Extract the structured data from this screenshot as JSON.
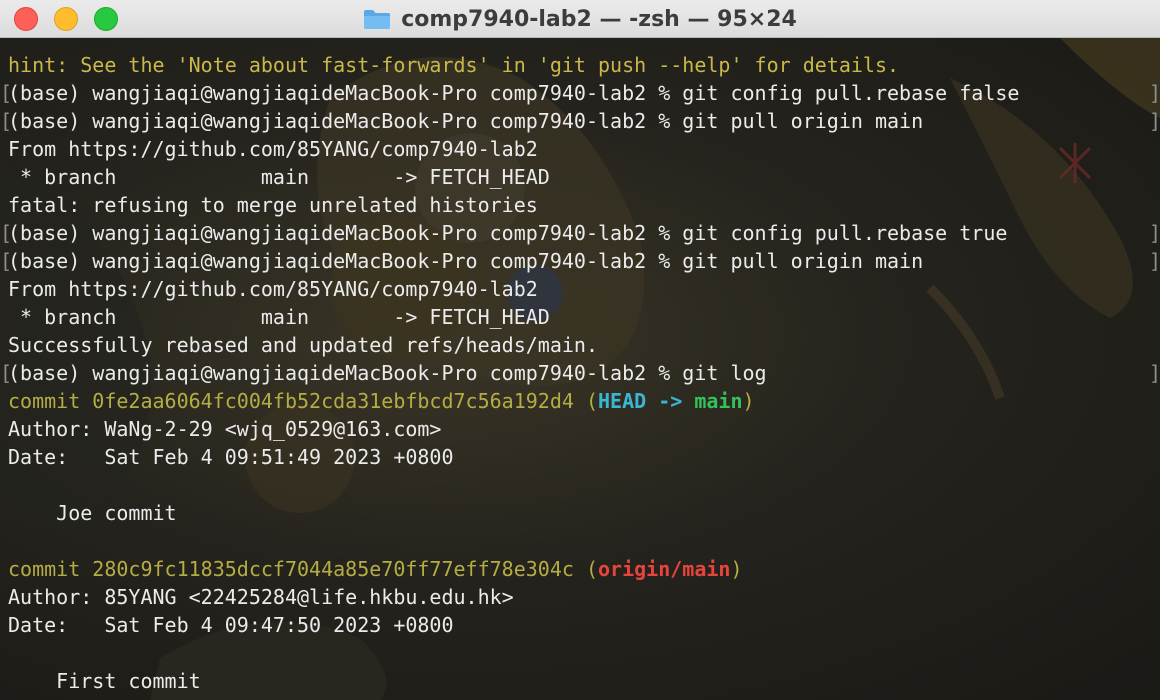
{
  "window": {
    "title": "comp7940-lab2 — -zsh — 95×24",
    "folder_color": "#5aa9e6"
  },
  "colors": {
    "hint": "#c9b84a",
    "commit": "#b5ad44",
    "head": "#39b8d4",
    "branch_local": "#34c25a",
    "branch_remote": "#e8443b"
  },
  "terminal": {
    "hint": "hint: See the 'Note about fast-forwards' in 'git push --help' for details.",
    "cmd1": "(base) wangjiaqi@wangjiaqideMacBook-Pro comp7940-lab2 % git config pull.rebase false",
    "cmd2": "(base) wangjiaqi@wangjiaqideMacBook-Pro comp7940-lab2 % git pull origin main",
    "from1": "From https://github.com/85YANG/comp7940-lab2",
    "branch1": " * branch            main       -> FETCH_HEAD",
    "fatal": "fatal: refusing to merge unrelated histories",
    "cmd3": "(base) wangjiaqi@wangjiaqideMacBook-Pro comp7940-lab2 % git config pull.rebase true",
    "cmd4": "(base) wangjiaqi@wangjiaqideMacBook-Pro comp7940-lab2 % git pull origin main",
    "from2": "From https://github.com/85YANG/comp7940-lab2",
    "branch2": " * branch            main       -> FETCH_HEAD",
    "success": "Successfully rebased and updated refs/heads/main.",
    "cmd5": "(base) wangjiaqi@wangjiaqideMacBook-Pro comp7940-lab2 % git log",
    "commit1": {
      "prefix": "commit 0fe2aa6064fc004fb52cda31ebfbcd7c56a192d4 (",
      "head": "HEAD -> ",
      "branch": "main",
      "suffix": ")",
      "author": "Author: WaNg-2-29 <wjq_0529@163.com>",
      "date": "Date:   Sat Feb 4 09:51:49 2023 +0800",
      "message": "    Joe commit"
    },
    "commit2": {
      "prefix": "commit 280c9fc11835dccf7044a85e70ff77eff78e304c (",
      "branch": "origin/main",
      "suffix": ")",
      "author": "Author: 85YANG <22425284@life.hkbu.edu.hk>",
      "date": "Date:   Sat Feb 4 09:47:50 2023 +0800",
      "message": "    First commit"
    },
    "bracket_open": "[",
    "bracket_close": "]"
  }
}
